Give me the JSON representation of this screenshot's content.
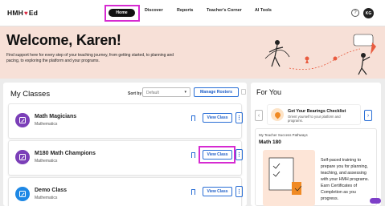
{
  "brand": {
    "logo_prefix": "HMH",
    "logo_suffix": "Ed",
    "accent": "#d62ad1"
  },
  "nav": {
    "home": "Home",
    "discover": "Discover",
    "reports": "Reports",
    "teachers_corner": "Teacher's Corner",
    "ai_tools": "AI Tools"
  },
  "header": {
    "help": "?",
    "avatar_initials": "KG"
  },
  "hero": {
    "title": "Welcome, Karen!",
    "subtitle": "Find support here for every step of your teaching journey, from getting started, to planning and pacing, to exploring the platform and your programs."
  },
  "classes": {
    "heading": "My Classes",
    "sort_label": "Sort by",
    "sort_value": "Default",
    "manage_label": "Manage Rosters",
    "view_label": "View Class",
    "items": [
      {
        "name": "Math Magicians",
        "subject": "Mathematics",
        "color": "#7b3fb8"
      },
      {
        "name": "M180 Math Champions",
        "subject": "Mathematics",
        "color": "#7b3fb8"
      },
      {
        "name": "Demo Class",
        "subject": "Mathematics",
        "color": "#1e88e5"
      }
    ]
  },
  "foryou": {
    "heading": "For You",
    "checklist_title": "Get Your Bearings Checklist",
    "checklist_desc": "Orient yourself to your platform and programs.",
    "pathway_kicker": "My Teacher Success Pathways",
    "pathway_title": "Math 180",
    "pathway_desc": "Self-paced training to prepare you for planning, teaching, and assessing with your HMH programs. Earn Certificates of Completion as you progress."
  }
}
